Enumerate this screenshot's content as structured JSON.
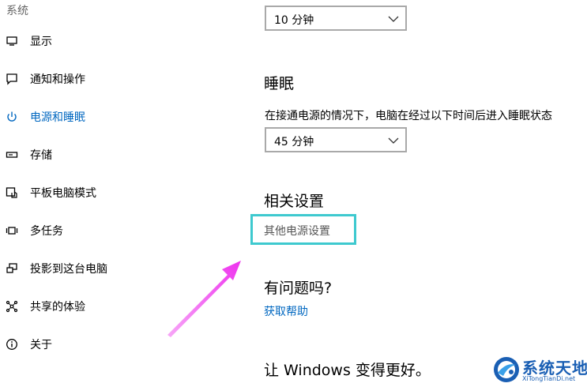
{
  "sidebar": {
    "section_header": "系统",
    "items": [
      {
        "label": "显示",
        "icon": "display-icon",
        "active": false
      },
      {
        "label": "通知和操作",
        "icon": "notification-icon",
        "active": false
      },
      {
        "label": "电源和睡眠",
        "icon": "power-icon",
        "active": true
      },
      {
        "label": "存储",
        "icon": "storage-icon",
        "active": false
      },
      {
        "label": "平板电脑模式",
        "icon": "tablet-mode-icon",
        "active": false
      },
      {
        "label": "多任务",
        "icon": "multitasking-icon",
        "active": false
      },
      {
        "label": "投影到这台电脑",
        "icon": "project-icon",
        "active": false
      },
      {
        "label": "共享的体验",
        "icon": "shared-experience-icon",
        "active": false
      },
      {
        "label": "关于",
        "icon": "info-icon",
        "active": false
      }
    ]
  },
  "main": {
    "screen_dropdown": {
      "value": "10 分钟"
    },
    "sleep": {
      "heading": "睡眠",
      "description": "在接通电源的情况下，电脑在经过以下时间后进入睡眠状态",
      "dropdown": {
        "value": "45 分钟"
      }
    },
    "related": {
      "heading": "相关设置",
      "link": "其他电源设置"
    },
    "help": {
      "heading": "有问题吗?",
      "link": "获取帮助"
    },
    "feedback": {
      "heading": "让 Windows 变得更好。"
    }
  },
  "annotation": {
    "highlight_color": "#3ec9cf",
    "arrow_color": "#ee44ee"
  },
  "watermark": {
    "title": "系统天地",
    "subtitle": "XiTongTianDi.net"
  }
}
